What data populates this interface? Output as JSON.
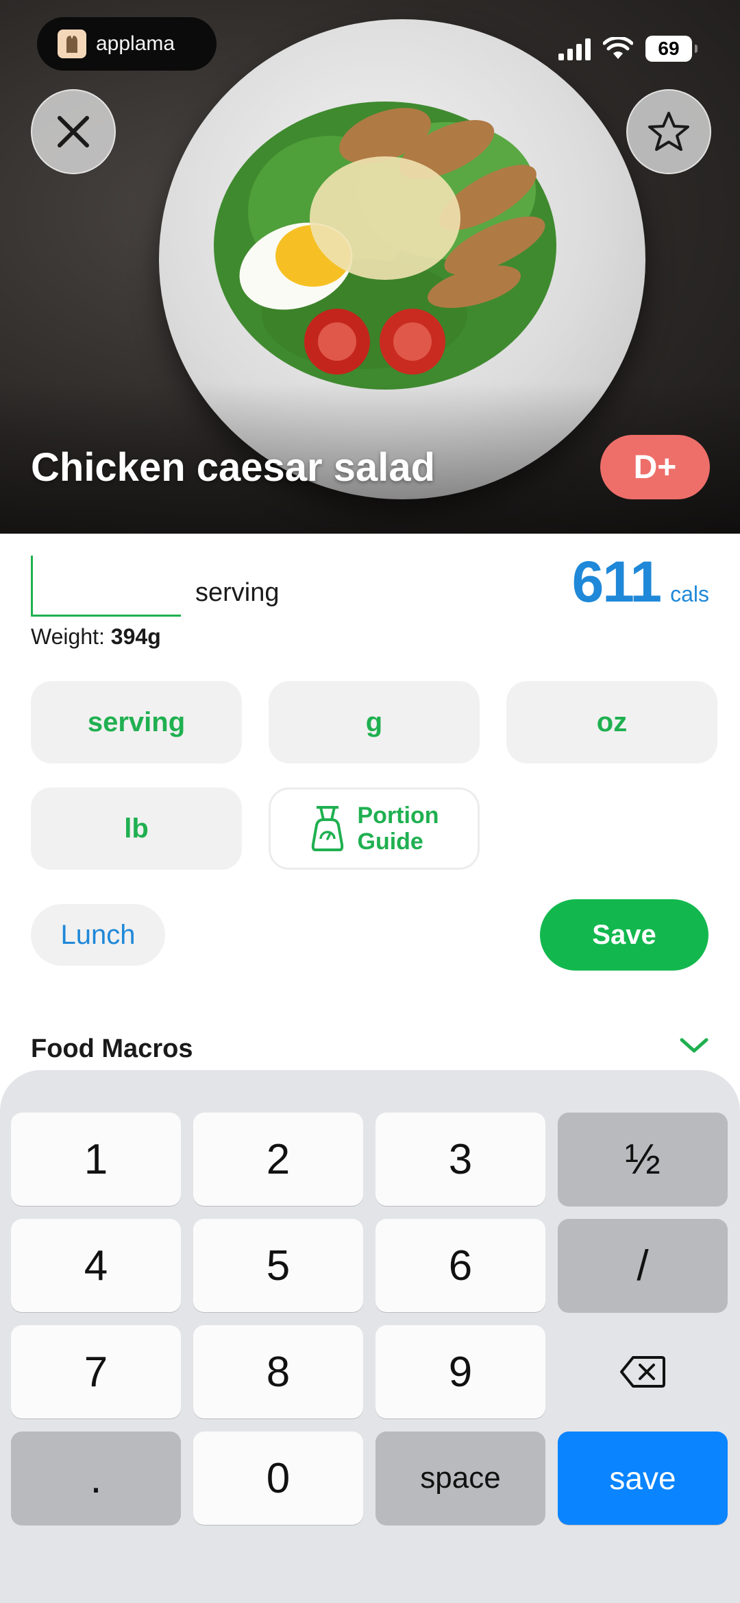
{
  "brand": {
    "name": "applama"
  },
  "status": {
    "battery": "69"
  },
  "food": {
    "title": "Chicken caesar salad",
    "grade": "D+"
  },
  "portion": {
    "quantity_value": "",
    "unit": "serving",
    "calories": "611",
    "calories_unit": "cals",
    "weight_label": "Weight:",
    "weight_value": "394g"
  },
  "units": [
    "serving",
    "g",
    "oz",
    "lb"
  ],
  "portion_guide": {
    "line1": "Portion",
    "line2": "Guide"
  },
  "meal": "Lunch",
  "save_label": "Save",
  "macros": {
    "title": "Food Macros"
  },
  "keyboard": {
    "rows": [
      [
        "1",
        "2",
        "3",
        "½"
      ],
      [
        "4",
        "5",
        "6",
        "/"
      ],
      [
        "7",
        "8",
        "9",
        "delete-icon"
      ],
      [
        ".",
        "0",
        "space",
        "save"
      ]
    ]
  },
  "colors": {
    "accent_green": "#12b84e",
    "calorie_blue": "#1f88d8",
    "grade_red": "#ee6f6a",
    "key_blue": "#0a84ff"
  }
}
